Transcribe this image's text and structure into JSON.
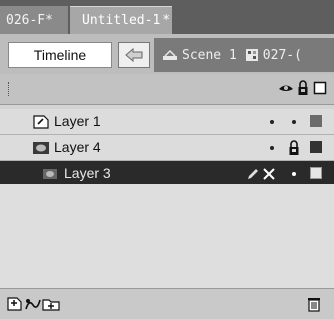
{
  "tabs": [
    {
      "label": "026-F*"
    },
    {
      "label": "Untitled-1",
      "close_glyph": "*"
    }
  ],
  "toolbar": {
    "timeline_label": "Timeline",
    "back_icon": "back-arrow-icon",
    "crumbs": [
      {
        "icon": "scene-icon",
        "label": "Scene 1"
      },
      {
        "icon": "symbol-icon",
        "label": "027-("
      }
    ]
  },
  "header": {
    "icons": [
      "eye-icon",
      "lock-icon",
      "outline-icon"
    ]
  },
  "layers": [
    {
      "name": "Layer 1",
      "icon": "layer-page-icon",
      "selected": false,
      "swatch": "#6b6b6b"
    },
    {
      "name": "Layer 4",
      "icon": "mask-layer-icon",
      "selected": false,
      "swatch": "#333333"
    },
    {
      "name": "Layer 3",
      "icon": "masked-layer-icon",
      "selected": true,
      "swatch": "#e6e6e6"
    }
  ],
  "footer": {
    "icons": [
      "insert-layer-icon",
      "add-motion-guide-icon",
      "insert-folder-icon",
      "trash-icon"
    ]
  }
}
